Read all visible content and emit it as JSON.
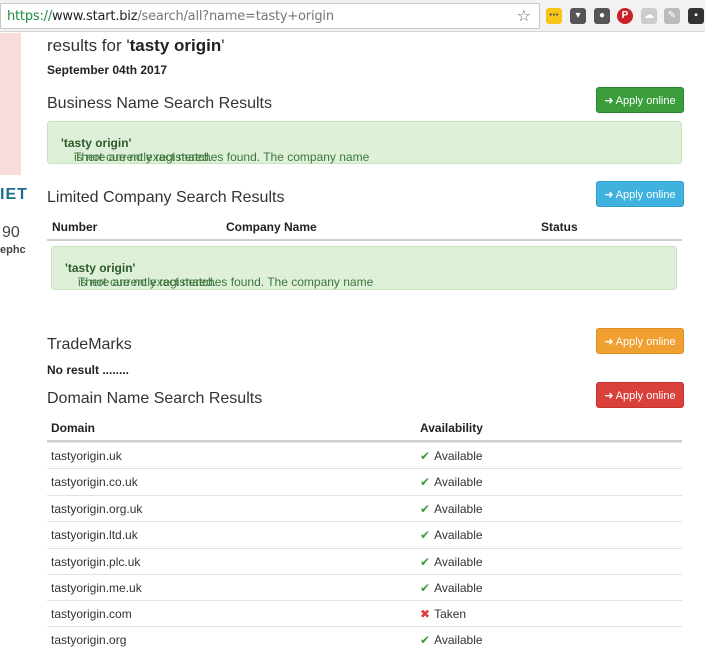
{
  "browser": {
    "url_scheme": "https://",
    "url_host": "www.start.biz",
    "url_path": "/search/all?name=tasty+origin"
  },
  "left_panel": {
    "fragment1": "IET",
    "fragment2": "90",
    "fragment3": "ephc"
  },
  "header": {
    "results_prefix": "results for '",
    "query": "tasty origin",
    "results_suffix": "'",
    "date": "September 04th 2017"
  },
  "business": {
    "title": "Business Name Search Results",
    "button": "Apply online",
    "msg_prefix": "There are no exact matches found. The company name ",
    "msg_name": "'tasty origin'",
    "msg_suffix": " is not currently registered."
  },
  "limited": {
    "title": "Limited Company Search Results",
    "button": "Apply online",
    "columns": [
      "Number",
      "Company Name",
      "Status"
    ],
    "msg_prefix": "There are no exact matches found. The company name ",
    "msg_name": "'tasty origin'",
    "msg_suffix": " is not currently registered."
  },
  "trademarks": {
    "title": "TradeMarks",
    "button": "Apply online",
    "no_result": "No result ........"
  },
  "domains": {
    "title": "Domain Name Search Results",
    "button": "Apply online",
    "columns": [
      "Domain",
      "Availability"
    ],
    "rows": [
      {
        "domain": "tastyorigin.uk",
        "status": "Available"
      },
      {
        "domain": "tastyorigin.co.uk",
        "status": "Available"
      },
      {
        "domain": "tastyorigin.org.uk",
        "status": "Available"
      },
      {
        "domain": "tastyorigin.ltd.uk",
        "status": "Available"
      },
      {
        "domain": "tastyorigin.plc.uk",
        "status": "Available"
      },
      {
        "domain": "tastyorigin.me.uk",
        "status": "Available"
      },
      {
        "domain": "tastyorigin.com",
        "status": "Taken"
      },
      {
        "domain": "tastyorigin.org",
        "status": "Available"
      }
    ]
  },
  "colors": {
    "green": "#3a9d3a",
    "blue": "#3fb2df",
    "orange": "#f0a030",
    "red": "#d9403a",
    "alert_bg": "#dff0d8"
  }
}
